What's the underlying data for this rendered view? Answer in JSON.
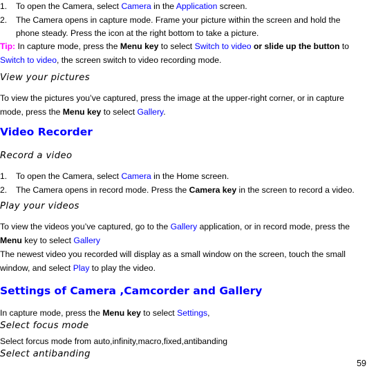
{
  "section_camera": {
    "steps": [
      {
        "num": "1.",
        "t1": "To open the Camera, select ",
        "link1": "Camera",
        "t2": " in the ",
        "link2": "Application",
        "t3": " screen."
      },
      {
        "num": "2.",
        "line1": "The Camera opens in capture mode. Frame your picture within the screen and hold the",
        "line2": "phone steady. Press the icon at the right bottom to take a picture."
      }
    ],
    "tip": {
      "label": "Tip:",
      "t1": " In capture mode, press the ",
      "bold1": "Menu key",
      "t2": " to select ",
      "link1": "Switch to video",
      "bold2": " or slide up the button",
      "t3": " to",
      "link2": "Switch to video",
      "t4": ", the screen switch to video recording mode."
    }
  },
  "view_pictures": {
    "title": "View your pictures",
    "line1": "To view the pictures you’ve captured, press the image at the upper-right corner, or in capture",
    "t1": "mode, press the ",
    "bold": "Menu key",
    "t2": " to select ",
    "link": "Gallery",
    "t3": "."
  },
  "video_recorder": {
    "heading": "Video Recorder",
    "record": {
      "title": "Record a video",
      "steps": [
        {
          "num": "1.",
          "t1": "To open the Camera, select ",
          "link": "Camera",
          "t2": " in the Home screen."
        },
        {
          "num": "2.",
          "t1": "The Camera opens in record mode. Press the ",
          "bold": "Camera key",
          "t2": " in the screen to record a video."
        }
      ]
    },
    "play": {
      "title": "Play your videos",
      "p1_t1": "To view the videos you’ve captured, go to the ",
      "p1_link": "Gallery",
      "p1_t2": " application, or in record mode, press the",
      "p1_bold": "Menu",
      "p1_t3": " key to select ",
      "p1_link2": "Gallery",
      "p2_line1": "The newest video you recorded will display as a small window on the screen, touch the small",
      "p2_t1": "window, and select ",
      "p2_link": "Play",
      "p2_t2": " to play the video."
    }
  },
  "settings": {
    "heading": "Settings of Camera ,Camcorder and Gallery",
    "t1": "In capture mode, press the ",
    "bold": "Menu key",
    "t2": " to select ",
    "link": "Settings",
    "t3": ",",
    "focus_title": "Select focus mode",
    "focus_text": "Select forcus mode from auto,infinity,macro,fixed,antibanding",
    "antibanding_title": "Select antibanding"
  },
  "page_number": "59"
}
